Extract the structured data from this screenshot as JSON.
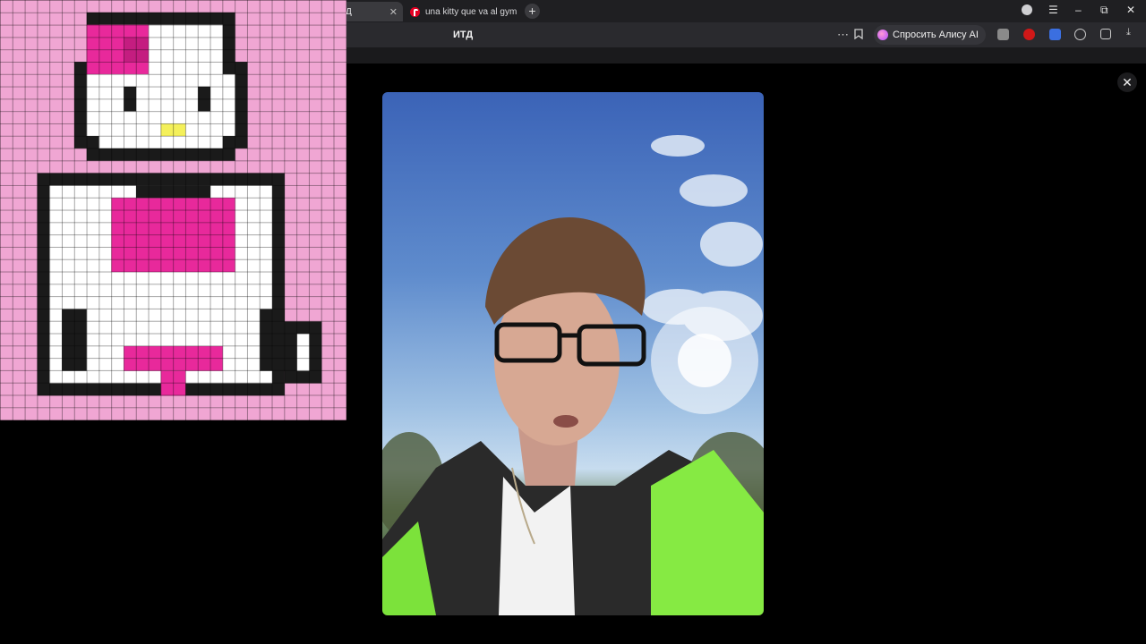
{
  "browser": {
    "tabs": [
      {
        "label": "Д",
        "active": true
      },
      {
        "label": "una kitty que va al gym",
        "active": false
      }
    ],
    "page_title": "ИТД",
    "alice_button_label": "Спросить Алису AI",
    "icons": {
      "new_tab": "+",
      "menu": "☰",
      "minimize": "–",
      "restore": "⧉",
      "close": "✕",
      "more": "⋯",
      "bookmark": "🔖"
    }
  },
  "viewer": {
    "close_label": "✕"
  },
  "colors": {
    "tabbar_bg": "#1f1f22",
    "addressbar_bg": "#2a2a2e",
    "pixel_pink": "#f0a6d3",
    "pixel_magenta": "#e8299b",
    "pixel_black": "#1a1a1a"
  }
}
